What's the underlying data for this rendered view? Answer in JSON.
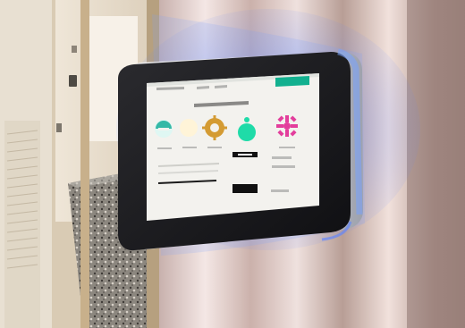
{
  "scene": {
    "description_free": true,
    "colors": {
      "wall": "#c9b79d",
      "door_panel": "#e9e2d6",
      "carpet_base": "#6f6a63",
      "curtain_light": "#e8d7d6",
      "curtain_dark": "#aa958d",
      "device_case": "#1a1a1d",
      "screen_bg": "#f4f4f1",
      "glow": "#5f84ff",
      "accent_green": "#16d19f",
      "accent_magenta": "#e5409d",
      "accent_teal": "#16c0b0"
    }
  },
  "screen": {
    "top_bar_button_color": "#12b08f",
    "options": [
      {
        "name": "sunrise-icon",
        "label": "",
        "color": "#35b8a6"
      },
      {
        "name": "moon-icon",
        "label": "",
        "color": "#f0c04a"
      },
      {
        "name": "gear-icon",
        "label": "",
        "color": "#d49b33"
      },
      {
        "name": "apple-icon",
        "label": "",
        "color": "#1fdba8"
      },
      {
        "name": "pinwheel-icon",
        "label": "",
        "color": "#e33e9c"
      }
    ]
  }
}
